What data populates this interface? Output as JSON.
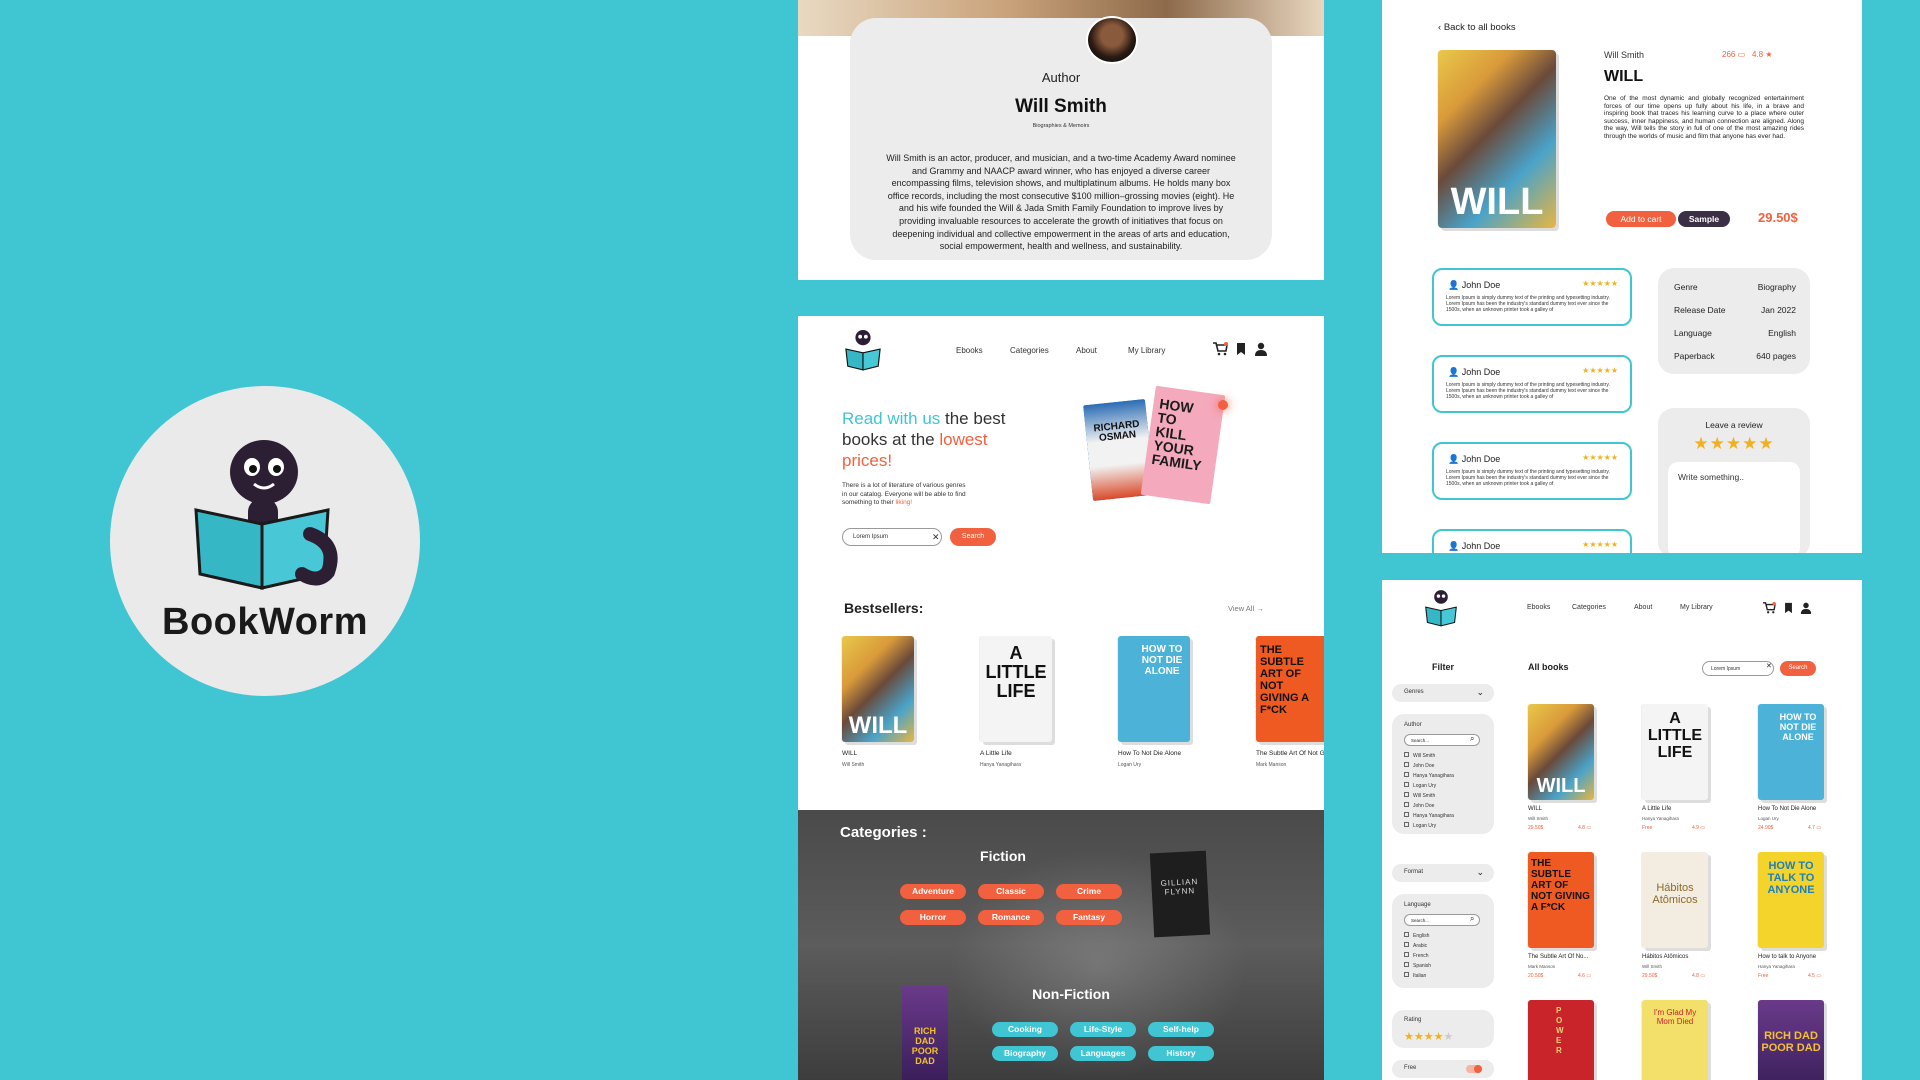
{
  "logo": {
    "name": "BookWorm",
    "icon": "bookworm-mascot-icon"
  },
  "author_page": {
    "role": "Author",
    "name": "Will Smith",
    "genre": "Biographies & Memoirs",
    "bio": "Will Smith is an actor, producer, and musician, and a two-time Academy Award nominee and Grammy and NAACP award winner, who has enjoyed a diverse career encompassing films, television shows, and multiplatinum albums. He holds many box office records, including the most consecutive $100 million–grossing movies (eight). He and his wife founded the Will & Jada Smith Family Foundation to improve lives by providing invaluable resources to accelerate the growth of initiatives that focus on deepening individual and collective empowerment in the areas of arts and education, social empowerment, health and wellness, and sustainability."
  },
  "home": {
    "nav": {
      "ebooks": "Ebooks",
      "categories": "Categories",
      "about": "About",
      "library": "My Library"
    },
    "hero": {
      "h1a": "Read with us",
      "h1b": " the best  books at the ",
      "h1c": "lowest prices!",
      "p1": "There is a lot of literature of various genres in our catalog. Everyone will be able to find something to their ",
      "p2": "liking!",
      "search_value": "Lorem Ipsum",
      "search_button": "Search",
      "cover_left": "RICHARD OSMAN",
      "cover_right": "HOW TO KILL YOUR FAMILY"
    },
    "bestsellers": {
      "title": "Bestsellers:",
      "view_all": "View All",
      "books": [
        {
          "title": "WILL",
          "author": "Will Smith",
          "cover": "WILL"
        },
        {
          "title": "A Little Life",
          "author": "Hanya Yanagihara",
          "cover": "A LITTLE LIFE"
        },
        {
          "title": "How To Not Die Alone",
          "author": "Logan Ury",
          "cover": "HOW TO NOT DIE ALONE"
        },
        {
          "title": "The Subtle Art Of Not Giving a F*ck",
          "author": "Mark Manson",
          "cover": "THE SUBTLE ART OF NOT GIVING A F*CK"
        }
      ]
    },
    "categories": {
      "title": "Categories :",
      "fiction_title": "Fiction",
      "fiction": [
        "Adventure",
        "Classic",
        "Crime",
        "Horror",
        "Romance",
        "Fantasy"
      ],
      "nonfiction_title": "Non-Fiction",
      "nonfiction": [
        "Cooking",
        "Life-Style",
        "Self-help",
        "Biography",
        "Languages",
        "History"
      ],
      "cover_gone": "GILLIAN FLYNN",
      "cover_rich": "RICH DAD POOR DAD"
    }
  },
  "detail": {
    "back": "Back to all books",
    "author": "Will Smith",
    "reviews_count": "266",
    "rating": "4.8",
    "title": "WILL",
    "cover": "WILL",
    "description": "One of the most dynamic and globally recognized entertainment forces of our time opens up fully about his life, in a brave and inspiring book that traces his learning curve to a place where outer success, inner happiness, and human connection are aligned. Along the way, Will tells the story in full of one of the most amazing rides through the worlds of music and film that anyone has ever had.",
    "add_to_cart": "Add to cart",
    "sample": "Sample",
    "price": "29.50$",
    "reviews": [
      {
        "name": "John Doe",
        "stars": "★★★★★",
        "text": "Lorem Ipsum is simply dummy text of the printing and typesetting industry. Lorem Ipsum has been the industry's standard dummy text ever since the 1500s, when an unknown printer took a galley of"
      },
      {
        "name": "John Doe",
        "stars": "★★★★★",
        "text": "Lorem Ipsum is simply dummy text of the printing and typesetting industry. Lorem Ipsum has been the industry's standard dummy text ever since the 1500s, when an unknown printer took a galley of"
      },
      {
        "name": "John Doe",
        "stars": "★★★★★",
        "text": "Lorem Ipsum is simply dummy text of the printing and typesetting industry. Lorem Ipsum has been the industry's standard dummy text ever since the 1500s, when an unknown printer took a galley of"
      },
      {
        "name": "John Doe",
        "stars": "★★★★★",
        "text": ""
      }
    ],
    "info": [
      {
        "key": "Genre",
        "value": "Biography"
      },
      {
        "key": "Release Date",
        "value": "Jan 2022"
      },
      {
        "key": "Language",
        "value": "English"
      },
      {
        "key": "Paperback",
        "value": "640 pages"
      }
    ],
    "leave_review": "Leave a review",
    "leave_stars": "★★★★★",
    "leave_placeholder": "Write something.."
  },
  "all_books": {
    "nav": {
      "ebooks": "Ebooks",
      "categories": "Categories",
      "about": "About",
      "library": "My Library"
    },
    "filter_title": "Filter",
    "genres": "Genres",
    "author_label": "Author",
    "search_placeholder": "Search...",
    "authors": [
      "Will Smith",
      "John Doe",
      "Hanya Yanagihara",
      "Logan Ury",
      "Will Smith",
      "John Doe",
      "Hanya Yanagihara",
      "Logan Ury"
    ],
    "format": "Format",
    "language_label": "Language",
    "languages": [
      "English",
      "Arabic",
      "French",
      "Spanish",
      "Italian"
    ],
    "rating_label": "Rating",
    "rating_stars": "★★★★",
    "rating_empty": "★",
    "free_label": "Free",
    "heading": "All books",
    "search_value": "Lorem Ipsum",
    "search_button": "Search",
    "books": [
      {
        "title": "WILL",
        "author": "Will Smith",
        "price": "29.50$",
        "rating": "4.8",
        "cover": "WILL"
      },
      {
        "title": "A Little Life",
        "author": "Hanya Yanagihara",
        "price": "Free",
        "rating": "4.9",
        "cover": "A LITTLE LIFE"
      },
      {
        "title": "How To Not Die Alone",
        "author": "Logan Ury",
        "price": "24.90$",
        "rating": "4.7",
        "cover": "HOW TO NOT DIE ALONE"
      },
      {
        "title": "The Subtle Art Of No...",
        "author": "Mark Manson",
        "price": "20.50$",
        "rating": "4.6",
        "cover": "THE SUBTLE ART OF NOT GIVING A F*CK"
      },
      {
        "title": "Hábitos Atômicos",
        "author": "Will Smith",
        "price": "29.50$",
        "rating": "4.8",
        "cover": "Hábitos Atômicos"
      },
      {
        "title": "How to talk to Anyone",
        "author": "Hanya Yanagihara",
        "price": "Free",
        "rating": "4.5",
        "cover": "HOW TO TALK TO ANYONE"
      },
      {
        "title": "",
        "author": "",
        "price": "",
        "rating": "",
        "cover": "POWER"
      },
      {
        "title": "",
        "author": "",
        "price": "",
        "rating": "",
        "cover": "I'm Glad My Mom Died"
      },
      {
        "title": "",
        "author": "",
        "price": "",
        "rating": "",
        "cover": "RICH DAD POOR DAD"
      }
    ]
  }
}
